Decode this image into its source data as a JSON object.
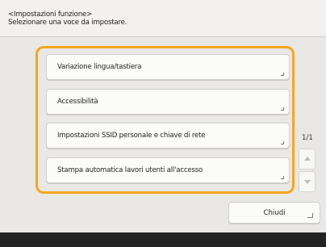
{
  "header": {
    "title": "<Impostazioni funzione>",
    "instruction": "Selezionare una voce da impostare."
  },
  "menu": {
    "items": [
      {
        "label": "Variazione lingua/tastiera"
      },
      {
        "label": "Accessibilità"
      },
      {
        "label": "Impostazioni SSID personale e chiave di rete"
      },
      {
        "label": "Stampa automatica lavori utenti all'accesso"
      }
    ]
  },
  "pagination": {
    "indicator": "1/1"
  },
  "footer": {
    "close_label": "Chiudi"
  },
  "colors": {
    "focus_frame": "#f5a61e",
    "background": "#f2f1ee",
    "bottom_bar": "#242424"
  }
}
